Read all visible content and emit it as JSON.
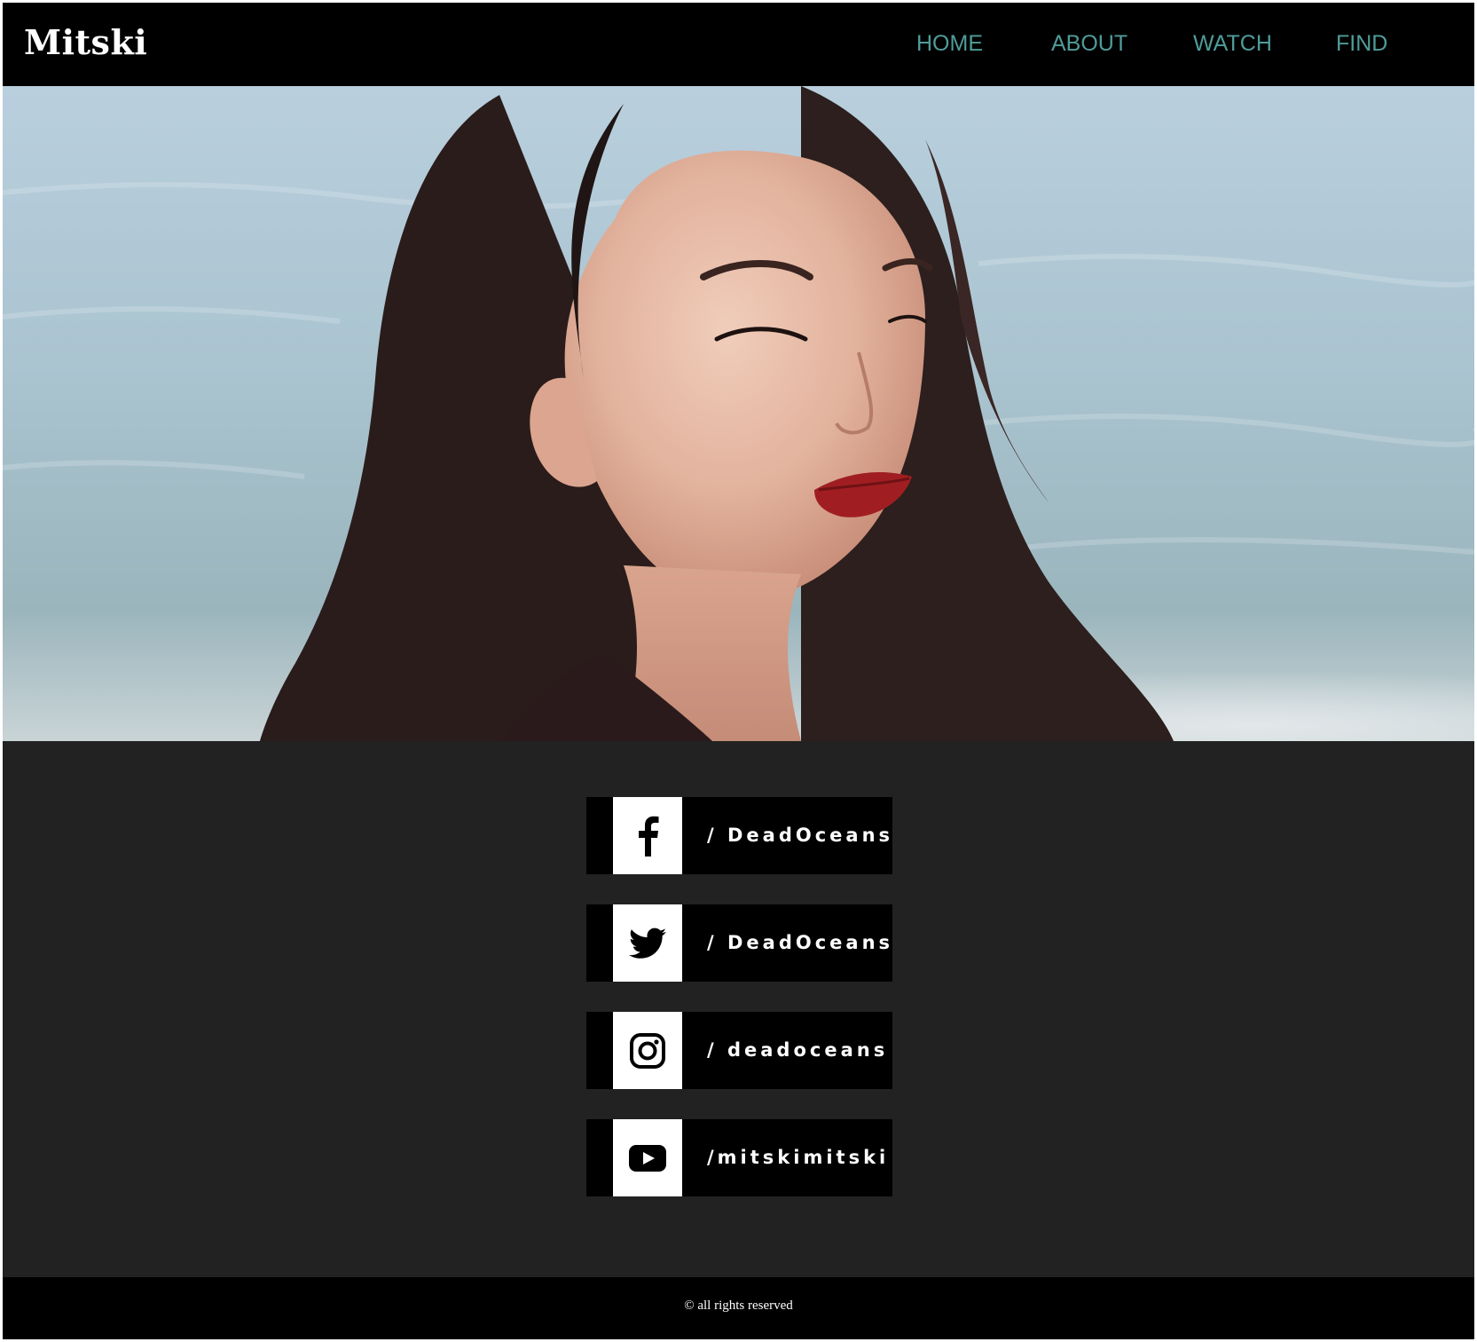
{
  "header": {
    "logo": "Mitski",
    "nav": [
      "HOME",
      "ABOUT",
      "WATCH",
      "FIND"
    ]
  },
  "hero": {
    "alt": "portrait-photo"
  },
  "socials": [
    {
      "icon": "facebook-icon",
      "handle": "/ DeadOceans"
    },
    {
      "icon": "twitter-icon",
      "handle": "/ DeadOceans"
    },
    {
      "icon": "instagram-icon",
      "handle": "/ deadoceans"
    },
    {
      "icon": "youtube-icon",
      "handle": "/mitskimitski"
    }
  ],
  "footer": {
    "copyright": "© all rights reserved"
  },
  "colors": {
    "nav_link": "#4f9c9a",
    "navbar_bg": "#000000",
    "body_bg": "#222222"
  }
}
